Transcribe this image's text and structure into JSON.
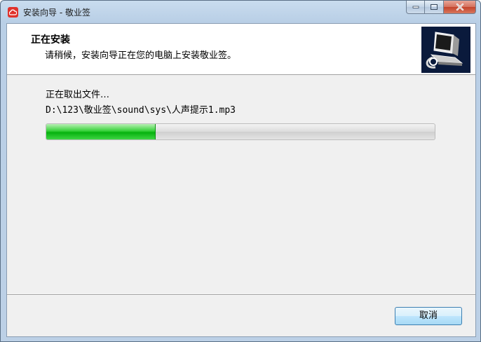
{
  "window": {
    "title": "安装向导 - 敬业签"
  },
  "caption_buttons": {
    "minimize_icon": "minimize-icon",
    "maximize_icon": "maximize-icon",
    "close_icon": "close-icon"
  },
  "header": {
    "title": "正在安装",
    "subtitle": "请稍候，安装向导正在您的电脑上安装敬业签。",
    "logo_icon": "installer-computer-icon"
  },
  "body": {
    "status": "正在取出文件…",
    "file_path": "D:\\123\\敬业签\\sound\\sys\\人声提示1.mp3",
    "progress_fraction": 0.28
  },
  "footer": {
    "cancel_label": "取消"
  },
  "colors": {
    "progress_green": "#06b20e",
    "app_icon_red": "#e0322c",
    "logo_background": "#0a1a3c"
  }
}
